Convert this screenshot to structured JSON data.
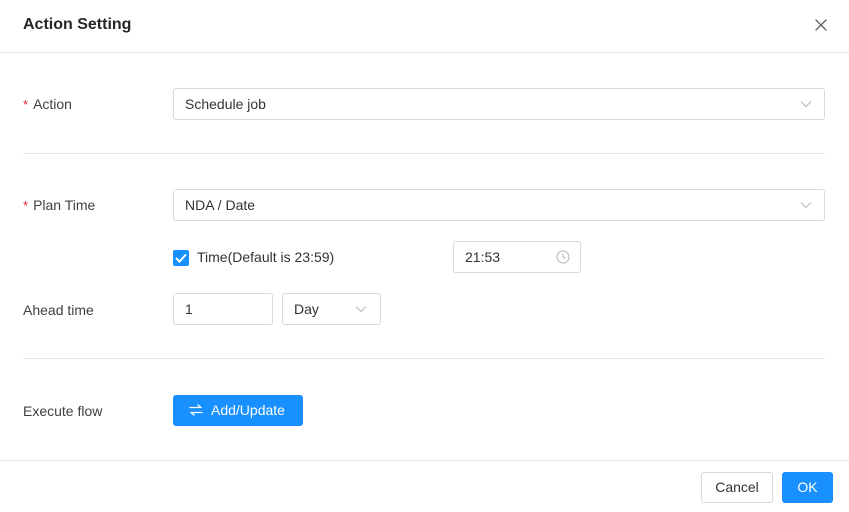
{
  "dialog": {
    "title": "Action Setting"
  },
  "form": {
    "action": {
      "label": "Action",
      "required_mark": "*",
      "value": "Schedule job"
    },
    "plan_time": {
      "label": "Plan Time",
      "required_mark": "*",
      "value": "NDA / Date"
    },
    "time_checkbox": {
      "label": "Time(Default is 23:59)",
      "checked": true
    },
    "time_picker": {
      "value": "21:53"
    },
    "ahead_time": {
      "label": "Ahead time",
      "amount": "1",
      "unit": "Day"
    },
    "execute_flow": {
      "label": "Execute flow",
      "button_label": "Add/Update"
    }
  },
  "footer": {
    "cancel_label": "Cancel",
    "ok_label": "OK"
  },
  "colors": {
    "primary": "#1890ff",
    "required": "#f5222d",
    "border": "#d9d9d9",
    "divider": "#e8e8e8"
  },
  "icons": {
    "close": "close-icon",
    "chevron": "chevron-down-icon",
    "clock": "clock-icon",
    "swap": "swap-icon",
    "check": "checkmark-icon"
  }
}
